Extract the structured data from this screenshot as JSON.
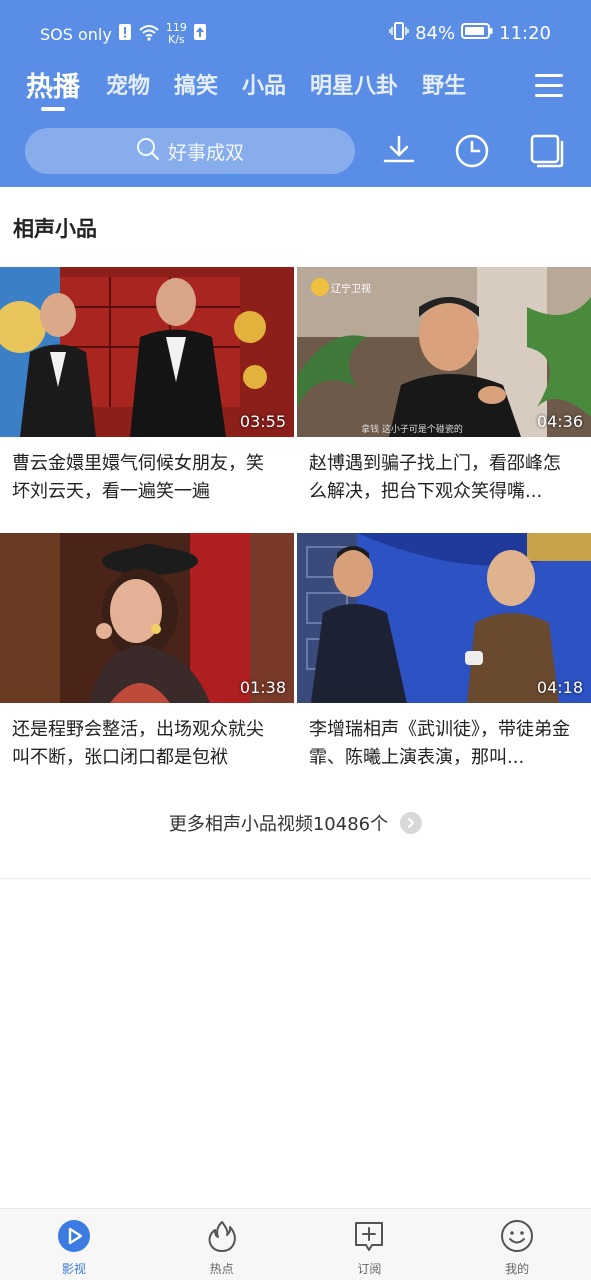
{
  "status_bar": {
    "carrier": "SOS only",
    "net_speed_value": "119",
    "net_speed_unit": "K/s",
    "battery": "84%",
    "time": "11:20"
  },
  "tabs": [
    "热播",
    "宠物",
    "搞笑",
    "小品",
    "明星八卦",
    "野生"
  ],
  "active_tab": 0,
  "search": {
    "placeholder": "好事成双"
  },
  "section": {
    "title": "相声小品"
  },
  "videos": [
    {
      "title": "曹云金嬛里嬛气伺候女朋友，笑坏刘云天，看一遍笑一遍",
      "duration": "03:55"
    },
    {
      "title": "赵博遇到骗子找上门，看邵峰怎么解决，把台下观众笑得嘴...",
      "duration": "04:36",
      "logo": "辽宁卫视",
      "caption": "拿钱  这小子可是个碰瓷的"
    },
    {
      "title": "还是程野会整活，出场观众就尖叫不断，张口闭口都是包袱",
      "duration": "01:38"
    },
    {
      "title": "李增瑞相声《武训徒》，带徒弟金霏、陈曦上演表演，那叫...",
      "duration": "04:18"
    }
  ],
  "more": {
    "label": "更多相声小品视频10486个"
  },
  "bottom_nav": [
    {
      "label": "影视",
      "icon": "play-circle-icon",
      "active": true
    },
    {
      "label": "热点",
      "icon": "flame-icon",
      "active": false
    },
    {
      "label": "订阅",
      "icon": "subscribe-plus-icon",
      "active": false
    },
    {
      "label": "我的",
      "icon": "smiley-icon",
      "active": false
    }
  ],
  "colors": {
    "header": "#5a8ee6",
    "active_nav": "#3b7be2"
  }
}
